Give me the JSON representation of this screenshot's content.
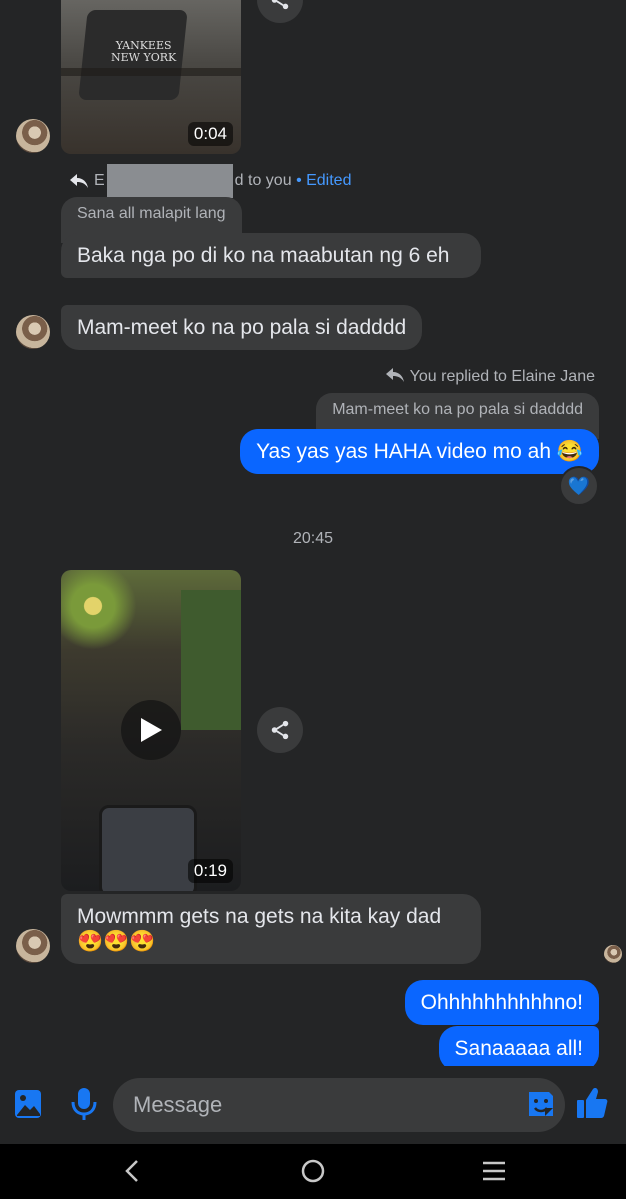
{
  "messages": {
    "video1_duration": "0:04",
    "reply_meta_pre": "E",
    "reply_meta_post": "d to you",
    "edited_label": "• Edited",
    "quote1": "Sana all malapit lang",
    "msg1": "Baka nga po di ko na maabutan ng 6 eh",
    "msg2": "Mam-meet ko na po pala si dadddd",
    "reply_meta_you": "You replied to Elaine Jane",
    "quote2": "Mam-meet ko na po pala si dadddd",
    "msg3": "Yas yas yas HAHA video mo ah 😂",
    "reaction": "💙",
    "timestamp": "20:45",
    "video2_duration": "0:19",
    "msg4": "Mowmmm gets na gets na kita kay dad😍😍😍",
    "msg5": "Ohhhhhhhhhhno!",
    "msg6": "Sanaaaaa all!"
  },
  "composer": {
    "placeholder": "Message"
  },
  "icons": {
    "gallery": "gallery-icon",
    "mic": "microphone-icon",
    "sticker": "sticker-icon",
    "like": "thumbs-up-icon"
  },
  "colors": {
    "background": "#242526",
    "incoming_bubble": "#3a3b3c",
    "outgoing_bubble": "#0a66ff",
    "accent": "#1877f2"
  }
}
